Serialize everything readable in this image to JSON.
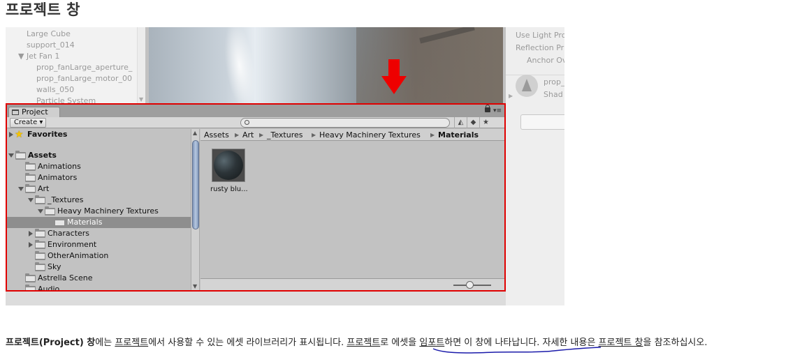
{
  "page": {
    "title": "프로젝트 창"
  },
  "hierarchy": {
    "items": [
      "Large Cube",
      "support_014",
      "Jet Fan 1",
      "prop_fanLarge_aperture_",
      "prop_fanLarge_motor_00",
      "walls_050",
      "Particle System"
    ]
  },
  "inspector": {
    "lines": [
      "Use Light Pro",
      "Reflection Pr",
      "Anchor Ov",
      "prop_",
      "Shad"
    ]
  },
  "project": {
    "tab_label": "Project",
    "create_label": "Create ▾",
    "tree": {
      "favorites": "Favorites",
      "assets": "Assets",
      "animations": "Animations",
      "animators": "Animators",
      "art": "Art",
      "textures": "_Textures",
      "heavy_machinery": "Heavy Machinery Textures",
      "materials": "Materials",
      "characters": "Characters",
      "environment": "Environment",
      "other_animation": "OtherAnimation",
      "sky": "Sky",
      "astrella_scene": "Astrella Scene",
      "audio": "Audio"
    },
    "breadcrumb": [
      "Assets",
      "Art",
      "_Textures",
      "Heavy Machinery Textures",
      "Materials"
    ],
    "asset": {
      "label": "rusty blu..."
    }
  },
  "caption": {
    "part1": "프로젝트(Project) 창",
    "part2": "에는 ",
    "part3": "프로젝트",
    "part4": "에서 사용할 수 있는 에셋 라이브러리가 표시됩니다. ",
    "part5": "프로젝트",
    "part6": "로 에셋을 ",
    "part7": "임포트",
    "part8": "하면 이 창에 나타납니다. 자세한 내용은 ",
    "part9": "프로젝트 창",
    "part10": "을 참조하십시오."
  },
  "colors": {
    "highlight_border": "#e00000",
    "annotation_line": "#1a1aaa",
    "scrollbar_thumb": "#7e95b8"
  }
}
